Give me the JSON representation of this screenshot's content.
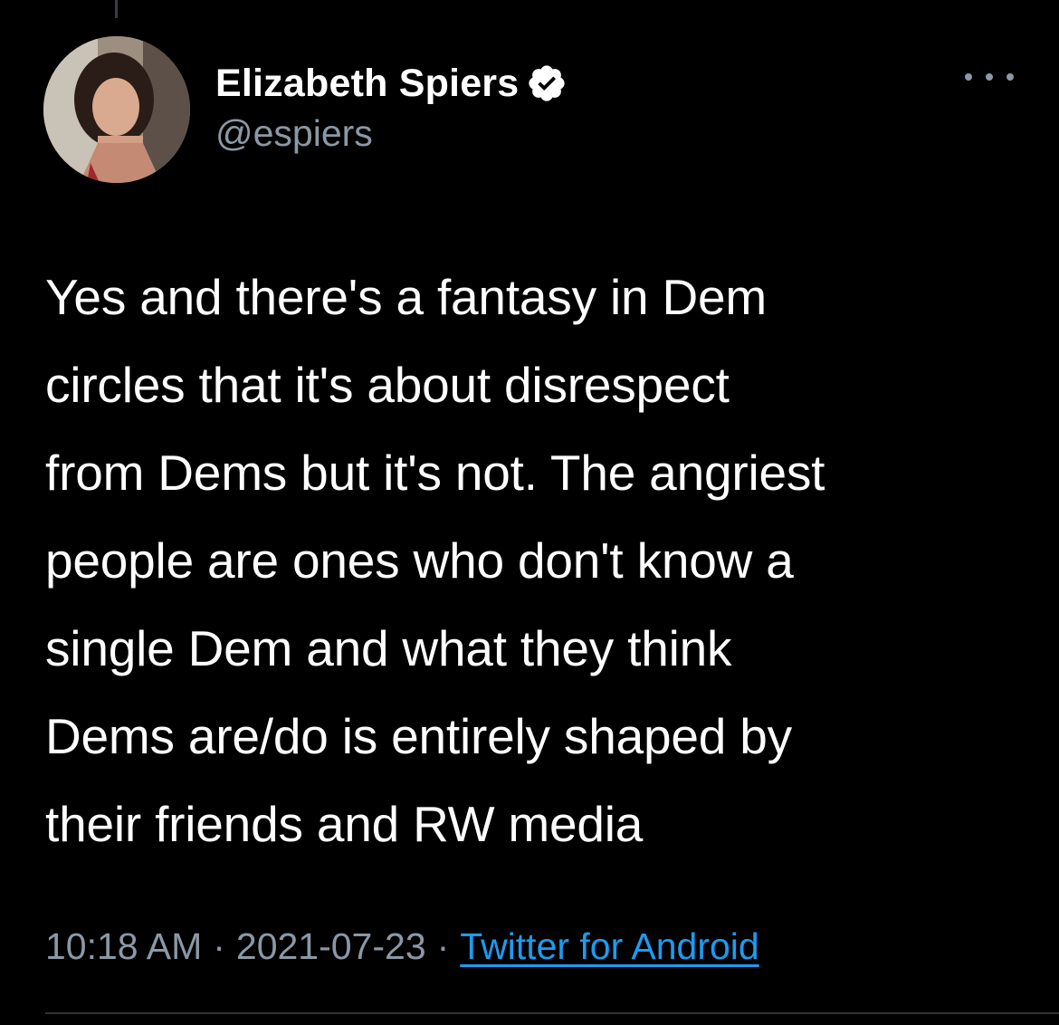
{
  "tweet": {
    "author": {
      "display_name": "Elizabeth Spiers",
      "handle": "@espiers",
      "verified": true
    },
    "text": "Yes and there's a fantasy in Dem\ncircles that it's about disrespect\nfrom Dems but it's not. The angriest\npeople are ones who don't know a\nsingle Dem and what they think\nDems are/do is entirely shaped by\ntheir friends and RW media",
    "time": "10:18 AM",
    "date": "2021-07-23",
    "separator": "·",
    "source": "Twitter for Android"
  },
  "icons": {
    "verified": "verified-badge-icon",
    "more": "more-options-icon"
  },
  "colors": {
    "background": "#000000",
    "text_primary": "#ffffff",
    "text_secondary": "#8b98a5",
    "link": "#1d9bf0",
    "divider": "#2f3336"
  }
}
